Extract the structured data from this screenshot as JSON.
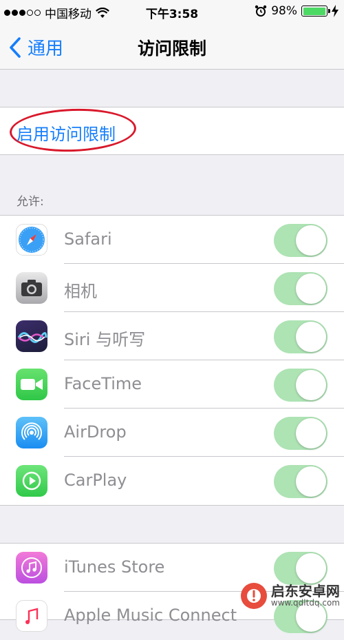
{
  "status_bar": {
    "carrier": "中国移动",
    "time": "下午3:58",
    "battery": "98%",
    "battery_level": 0.98,
    "icons": [
      "signal-dots-icon",
      "wifi-icon",
      "alarm-icon",
      "battery-icon",
      "charging-icon"
    ]
  },
  "nav": {
    "back_label": "通用",
    "title": "访问限制"
  },
  "enable": {
    "label": "启用访问限制",
    "annotation_color": "#d9182b"
  },
  "section_header": "允许:",
  "apps": [
    {
      "label": "Safari",
      "icon": "safari-icon",
      "on": true
    },
    {
      "label": "相机",
      "icon": "camera-icon",
      "on": true
    },
    {
      "label": "Siri 与听写",
      "icon": "siri-icon",
      "on": true
    },
    {
      "label": "FaceTime",
      "icon": "facetime-icon",
      "on": true
    },
    {
      "label": "AirDrop",
      "icon": "airdrop-icon",
      "on": true
    },
    {
      "label": "CarPlay",
      "icon": "carplay-icon",
      "on": true
    }
  ],
  "apps2": [
    {
      "label": "iTunes Store",
      "icon": "itunes-icon",
      "on": true
    },
    {
      "label": "Apple Music Connect",
      "icon": "music-icon",
      "on": true
    }
  ],
  "watermark": {
    "main": "启东安卓网",
    "sub": "www.qdltdq.com"
  },
  "colors": {
    "accent": "#157efb",
    "toggle_on": "#aee3b4"
  }
}
